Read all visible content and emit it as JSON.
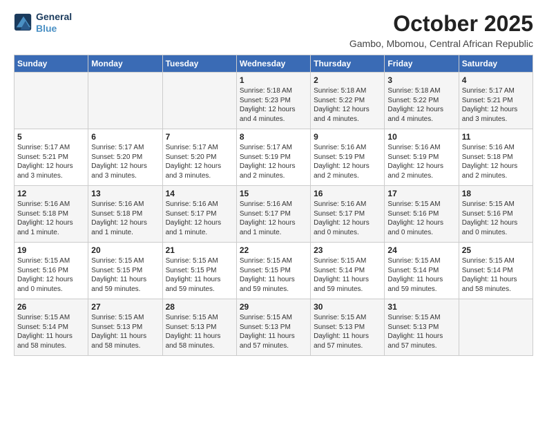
{
  "logo": {
    "line1": "General",
    "line2": "Blue"
  },
  "title": "October 2025",
  "subtitle": "Gambo, Mbomou, Central African Republic",
  "headers": [
    "Sunday",
    "Monday",
    "Tuesday",
    "Wednesday",
    "Thursday",
    "Friday",
    "Saturday"
  ],
  "weeks": [
    [
      {
        "day": "",
        "info": ""
      },
      {
        "day": "",
        "info": ""
      },
      {
        "day": "",
        "info": ""
      },
      {
        "day": "1",
        "info": "Sunrise: 5:18 AM\nSunset: 5:23 PM\nDaylight: 12 hours\nand 4 minutes."
      },
      {
        "day": "2",
        "info": "Sunrise: 5:18 AM\nSunset: 5:22 PM\nDaylight: 12 hours\nand 4 minutes."
      },
      {
        "day": "3",
        "info": "Sunrise: 5:18 AM\nSunset: 5:22 PM\nDaylight: 12 hours\nand 4 minutes."
      },
      {
        "day": "4",
        "info": "Sunrise: 5:17 AM\nSunset: 5:21 PM\nDaylight: 12 hours\nand 3 minutes."
      }
    ],
    [
      {
        "day": "5",
        "info": "Sunrise: 5:17 AM\nSunset: 5:21 PM\nDaylight: 12 hours\nand 3 minutes."
      },
      {
        "day": "6",
        "info": "Sunrise: 5:17 AM\nSunset: 5:20 PM\nDaylight: 12 hours\nand 3 minutes."
      },
      {
        "day": "7",
        "info": "Sunrise: 5:17 AM\nSunset: 5:20 PM\nDaylight: 12 hours\nand 3 minutes."
      },
      {
        "day": "8",
        "info": "Sunrise: 5:17 AM\nSunset: 5:19 PM\nDaylight: 12 hours\nand 2 minutes."
      },
      {
        "day": "9",
        "info": "Sunrise: 5:16 AM\nSunset: 5:19 PM\nDaylight: 12 hours\nand 2 minutes."
      },
      {
        "day": "10",
        "info": "Sunrise: 5:16 AM\nSunset: 5:19 PM\nDaylight: 12 hours\nand 2 minutes."
      },
      {
        "day": "11",
        "info": "Sunrise: 5:16 AM\nSunset: 5:18 PM\nDaylight: 12 hours\nand 2 minutes."
      }
    ],
    [
      {
        "day": "12",
        "info": "Sunrise: 5:16 AM\nSunset: 5:18 PM\nDaylight: 12 hours\nand 1 minute."
      },
      {
        "day": "13",
        "info": "Sunrise: 5:16 AM\nSunset: 5:18 PM\nDaylight: 12 hours\nand 1 minute."
      },
      {
        "day": "14",
        "info": "Sunrise: 5:16 AM\nSunset: 5:17 PM\nDaylight: 12 hours\nand 1 minute."
      },
      {
        "day": "15",
        "info": "Sunrise: 5:16 AM\nSunset: 5:17 PM\nDaylight: 12 hours\nand 1 minute."
      },
      {
        "day": "16",
        "info": "Sunrise: 5:16 AM\nSunset: 5:17 PM\nDaylight: 12 hours\nand 0 minutes."
      },
      {
        "day": "17",
        "info": "Sunrise: 5:15 AM\nSunset: 5:16 PM\nDaylight: 12 hours\nand 0 minutes."
      },
      {
        "day": "18",
        "info": "Sunrise: 5:15 AM\nSunset: 5:16 PM\nDaylight: 12 hours\nand 0 minutes."
      }
    ],
    [
      {
        "day": "19",
        "info": "Sunrise: 5:15 AM\nSunset: 5:16 PM\nDaylight: 12 hours\nand 0 minutes."
      },
      {
        "day": "20",
        "info": "Sunrise: 5:15 AM\nSunset: 5:15 PM\nDaylight: 11 hours\nand 59 minutes."
      },
      {
        "day": "21",
        "info": "Sunrise: 5:15 AM\nSunset: 5:15 PM\nDaylight: 11 hours\nand 59 minutes."
      },
      {
        "day": "22",
        "info": "Sunrise: 5:15 AM\nSunset: 5:15 PM\nDaylight: 11 hours\nand 59 minutes."
      },
      {
        "day": "23",
        "info": "Sunrise: 5:15 AM\nSunset: 5:14 PM\nDaylight: 11 hours\nand 59 minutes."
      },
      {
        "day": "24",
        "info": "Sunrise: 5:15 AM\nSunset: 5:14 PM\nDaylight: 11 hours\nand 59 minutes."
      },
      {
        "day": "25",
        "info": "Sunrise: 5:15 AM\nSunset: 5:14 PM\nDaylight: 11 hours\nand 58 minutes."
      }
    ],
    [
      {
        "day": "26",
        "info": "Sunrise: 5:15 AM\nSunset: 5:14 PM\nDaylight: 11 hours\nand 58 minutes."
      },
      {
        "day": "27",
        "info": "Sunrise: 5:15 AM\nSunset: 5:13 PM\nDaylight: 11 hours\nand 58 minutes."
      },
      {
        "day": "28",
        "info": "Sunrise: 5:15 AM\nSunset: 5:13 PM\nDaylight: 11 hours\nand 58 minutes."
      },
      {
        "day": "29",
        "info": "Sunrise: 5:15 AM\nSunset: 5:13 PM\nDaylight: 11 hours\nand 57 minutes."
      },
      {
        "day": "30",
        "info": "Sunrise: 5:15 AM\nSunset: 5:13 PM\nDaylight: 11 hours\nand 57 minutes."
      },
      {
        "day": "31",
        "info": "Sunrise: 5:15 AM\nSunset: 5:13 PM\nDaylight: 11 hours\nand 57 minutes."
      },
      {
        "day": "",
        "info": ""
      }
    ]
  ]
}
